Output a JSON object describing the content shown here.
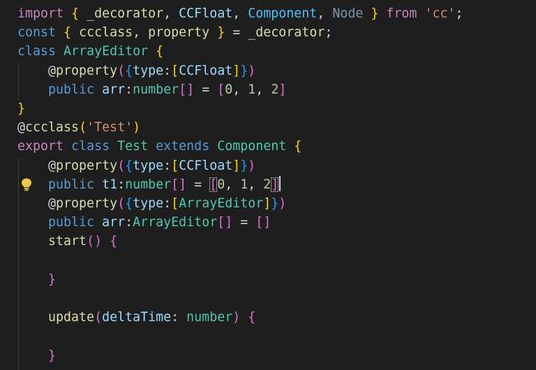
{
  "editor": {
    "lines": [
      [
        {
          "t": "import",
          "c": "#c586c0"
        },
        {
          "t": " "
        },
        {
          "t": "{",
          "c": "#ffd700"
        },
        {
          "t": " _decorator",
          "c": "#dcdcaa"
        },
        {
          "t": ", "
        },
        {
          "t": "CCFloat",
          "c": "#9cdcfe"
        },
        {
          "t": ", "
        },
        {
          "t": "Component",
          "c": "#4fc1ff"
        },
        {
          "t": ", "
        },
        {
          "t": "Node",
          "c": "#7d98b3"
        },
        {
          "t": " "
        },
        {
          "t": "}",
          "c": "#ffd700"
        },
        {
          "t": " "
        },
        {
          "t": "from",
          "c": "#c586c0"
        },
        {
          "t": " "
        },
        {
          "t": "'cc'",
          "c": "#ce9178"
        },
        {
          "t": ";"
        }
      ],
      [
        {
          "t": "const",
          "c": "#569cd6"
        },
        {
          "t": " "
        },
        {
          "t": "{",
          "c": "#ffd700"
        },
        {
          "t": " ccclass",
          "c": "#dcdcaa"
        },
        {
          "t": ", "
        },
        {
          "t": "property",
          "c": "#dcdcaa"
        },
        {
          "t": " "
        },
        {
          "t": "}",
          "c": "#ffd700"
        },
        {
          "t": " = "
        },
        {
          "t": "_decorator",
          "c": "#dcdcaa"
        },
        {
          "t": ";"
        }
      ],
      [
        {
          "t": "class",
          "c": "#569cd6"
        },
        {
          "t": " "
        },
        {
          "t": "ArrayEditor",
          "c": "#4ec9b0"
        },
        {
          "t": " "
        },
        {
          "t": "{",
          "c": "#ffd700"
        }
      ],
      [
        {
          "t": "    @"
        },
        {
          "t": "property",
          "c": "#dcdcaa"
        },
        {
          "t": "(",
          "c": "#da70d6"
        },
        {
          "t": "{",
          "c": "#179fff"
        },
        {
          "t": "type",
          "c": "#9cdcfe"
        },
        {
          "t": ":"
        },
        {
          "t": "[",
          "c": "#ffd700"
        },
        {
          "t": "CCFloat",
          "c": "#9cdcfe"
        },
        {
          "t": "]",
          "c": "#ffd700"
        },
        {
          "t": "}",
          "c": "#179fff"
        },
        {
          "t": ")",
          "c": "#da70d6"
        }
      ],
      [
        {
          "t": "    "
        },
        {
          "t": "public",
          "c": "#569cd6"
        },
        {
          "t": " "
        },
        {
          "t": "arr",
          "c": "#9cdcfe"
        },
        {
          "t": ":"
        },
        {
          "t": "number",
          "c": "#4ec9b0"
        },
        {
          "t": "[]",
          "c": "#da70d6"
        },
        {
          "t": " = "
        },
        {
          "t": "[",
          "c": "#da70d6"
        },
        {
          "t": "0",
          "c": "#b5cea8"
        },
        {
          "t": ", "
        },
        {
          "t": "1",
          "c": "#b5cea8"
        },
        {
          "t": ", "
        },
        {
          "t": "2",
          "c": "#b5cea8"
        },
        {
          "t": "]",
          "c": "#da70d6"
        }
      ],
      [
        {
          "t": "}",
          "c": "#ffd700"
        }
      ],
      [
        {
          "t": "@"
        },
        {
          "t": "ccclass",
          "c": "#dcdcaa"
        },
        {
          "t": "(",
          "c": "#ffd700"
        },
        {
          "t": "'Test'",
          "c": "#ce9178"
        },
        {
          "t": ")",
          "c": "#ffd700"
        }
      ],
      [
        {
          "t": "export",
          "c": "#c586c0"
        },
        {
          "t": " "
        },
        {
          "t": "class",
          "c": "#569cd6"
        },
        {
          "t": " "
        },
        {
          "t": "Test",
          "c": "#4ec9b0"
        },
        {
          "t": " "
        },
        {
          "t": "extends",
          "c": "#569cd6"
        },
        {
          "t": " "
        },
        {
          "t": "Component",
          "c": "#4ec9b0"
        },
        {
          "t": " "
        },
        {
          "t": "{",
          "c": "#ffd700"
        }
      ],
      [
        {
          "t": "    @"
        },
        {
          "t": "property",
          "c": "#dcdcaa"
        },
        {
          "t": "(",
          "c": "#da70d6"
        },
        {
          "t": "{",
          "c": "#179fff"
        },
        {
          "t": "type",
          "c": "#9cdcfe"
        },
        {
          "t": ":"
        },
        {
          "t": "[",
          "c": "#ffd700"
        },
        {
          "t": "CCFloat",
          "c": "#9cdcfe"
        },
        {
          "t": "]",
          "c": "#ffd700"
        },
        {
          "t": "}",
          "c": "#179fff"
        },
        {
          "t": ")",
          "c": "#da70d6"
        }
      ],
      [
        {
          "t": "    "
        },
        {
          "t": "public",
          "c": "#569cd6"
        },
        {
          "t": " "
        },
        {
          "t": "t1",
          "c": "#9cdcfe"
        },
        {
          "t": ":"
        },
        {
          "t": "number",
          "c": "#4ec9b0"
        },
        {
          "t": "[]",
          "c": "#da70d6"
        },
        {
          "t": " = "
        },
        {
          "t": "[",
          "c": "#da70d6",
          "box": true
        },
        {
          "t": "0",
          "c": "#b5cea8"
        },
        {
          "t": ", "
        },
        {
          "t": "1",
          "c": "#b5cea8"
        },
        {
          "t": ", "
        },
        {
          "t": "2",
          "c": "#b5cea8"
        },
        {
          "t": "]",
          "c": "#da70d6",
          "box": true
        },
        {
          "caret": true
        }
      ],
      [
        {
          "t": "    @"
        },
        {
          "t": "property",
          "c": "#dcdcaa"
        },
        {
          "t": "(",
          "c": "#da70d6"
        },
        {
          "t": "{",
          "c": "#179fff"
        },
        {
          "t": "type",
          "c": "#9cdcfe"
        },
        {
          "t": ":"
        },
        {
          "t": "[",
          "c": "#ffd700"
        },
        {
          "t": "ArrayEditor",
          "c": "#4ec9b0"
        },
        {
          "t": "]",
          "c": "#ffd700"
        },
        {
          "t": "}",
          "c": "#179fff"
        },
        {
          "t": ")",
          "c": "#da70d6"
        }
      ],
      [
        {
          "t": "    "
        },
        {
          "t": "public",
          "c": "#569cd6"
        },
        {
          "t": " "
        },
        {
          "t": "arr",
          "c": "#9cdcfe"
        },
        {
          "t": ":"
        },
        {
          "t": "ArrayEditor",
          "c": "#4ec9b0"
        },
        {
          "t": "[]",
          "c": "#da70d6"
        },
        {
          "t": " = "
        },
        {
          "t": "[]",
          "c": "#da70d6"
        }
      ],
      [
        {
          "t": "    "
        },
        {
          "t": "start",
          "c": "#dcdcaa"
        },
        {
          "t": "()",
          "c": "#da70d6"
        },
        {
          "t": " "
        },
        {
          "t": "{",
          "c": "#da70d6"
        }
      ],
      [],
      [
        {
          "t": "    "
        },
        {
          "t": "}",
          "c": "#da70d6"
        }
      ],
      [],
      [
        {
          "t": "    "
        },
        {
          "t": "update",
          "c": "#dcdcaa"
        },
        {
          "t": "(",
          "c": "#da70d6"
        },
        {
          "t": "deltaTime",
          "c": "#9cdcfe"
        },
        {
          "t": ": "
        },
        {
          "t": "number",
          "c": "#4ec9b0"
        },
        {
          "t": ")",
          "c": "#da70d6"
        },
        {
          "t": " "
        },
        {
          "t": "{",
          "c": "#da70d6"
        }
      ],
      [],
      [
        {
          "t": "    "
        },
        {
          "t": "}",
          "c": "#da70d6"
        }
      ]
    ],
    "lightbulb": {
      "icon": "lightbulb-icon",
      "color": "#f2c744"
    }
  }
}
